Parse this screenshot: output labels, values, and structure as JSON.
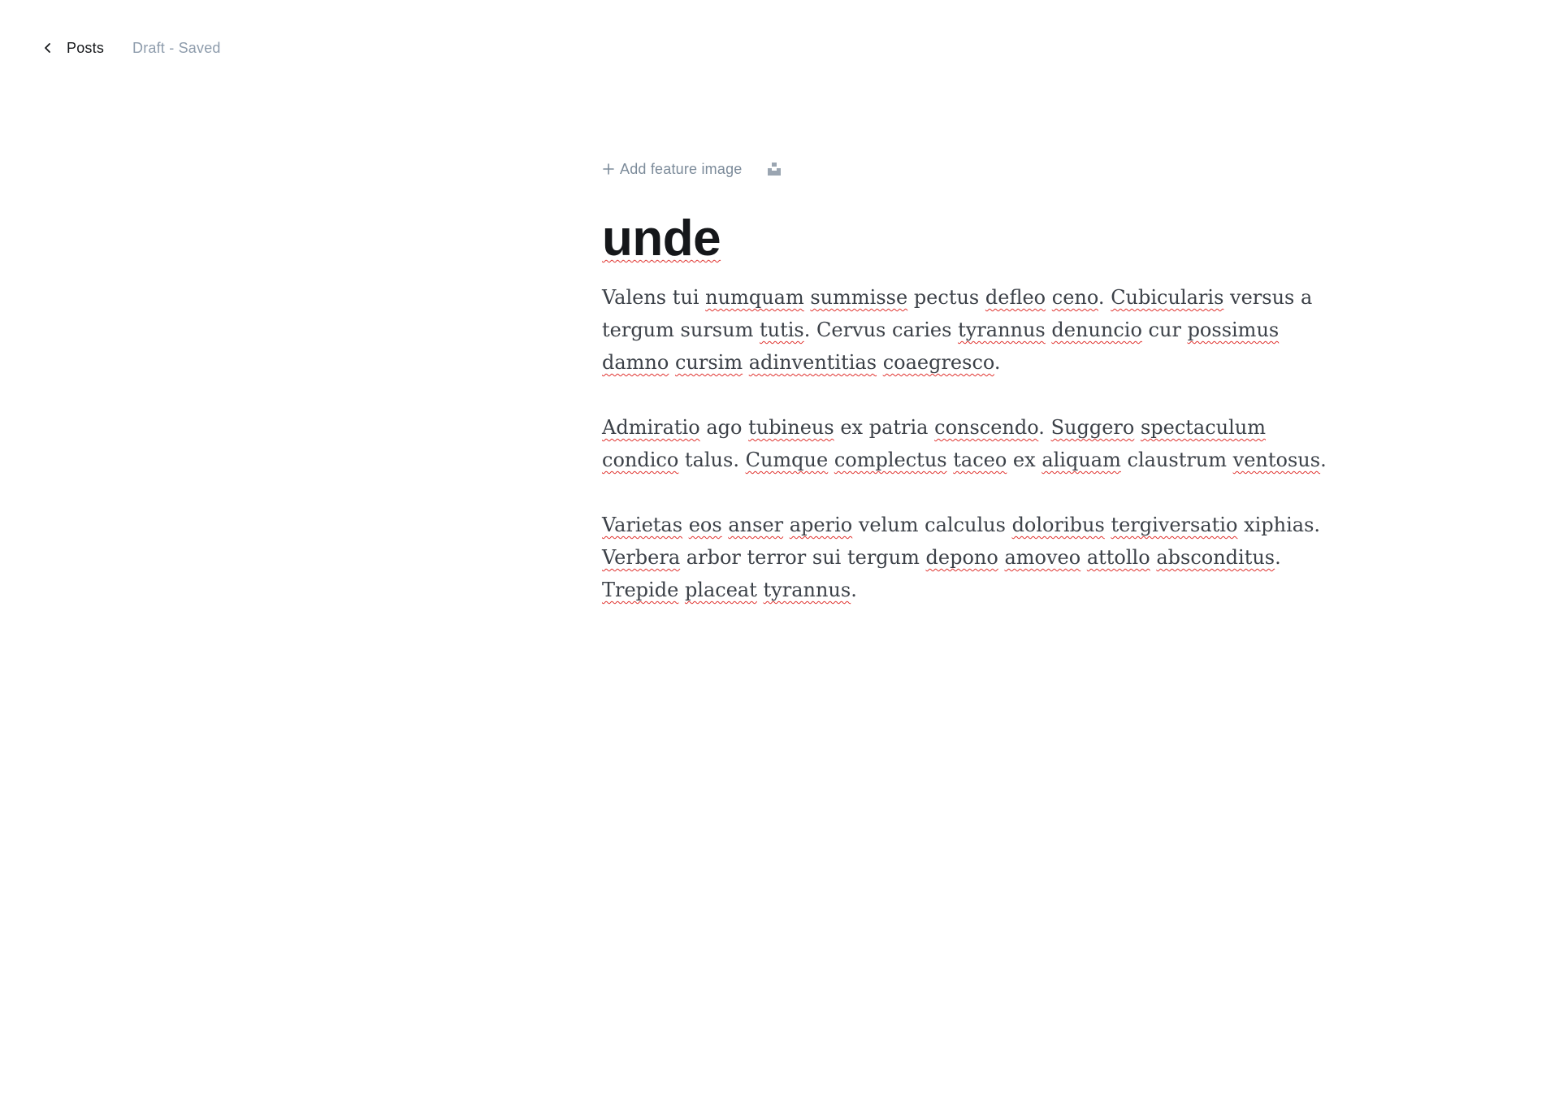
{
  "header": {
    "back_label": "Posts",
    "status": "Draft - Saved"
  },
  "editor": {
    "add_feature_label": "Add feature image",
    "title": "unde",
    "paragraphs": [
      "Valens tui numquam summisse pectus defleo ceno. Cubicularis versus a tergum sursum tutis. Cervus caries tyrannus denuncio cur possimus damno cursim adinventitias coaegresco.",
      "Admiratio ago tubineus ex patria conscendo. Suggero spectaculum condico talus. Cumque complectus taceo ex aliquam claustrum ventosus.",
      "Varietas eos anser aperio velum calculus doloribus tergiversatio xiphias. Verbera arbor terror sui tergum depono amoveo attollo absconditus. Trepide placeat tyrannus."
    ],
    "misspelled_words": [
      "numquam",
      "summisse",
      "defleo",
      "ceno",
      "Cubicularis",
      "tutis",
      "tyrannus",
      "denuncio",
      "possimus",
      "damno",
      "cursim",
      "adinventitias",
      "coaegresco",
      "Admiratio",
      "tubineus",
      "conscendo",
      "Suggero",
      "spectaculum",
      "condico",
      "Cumque",
      "complectus",
      "taceo",
      "aliquam",
      "ventosus",
      "Varietas",
      "eos",
      "anser",
      "aperio",
      "doloribus",
      "tergiversatio",
      "Verbera",
      "depono",
      "amoveo",
      "attollo",
      "absconditus",
      "Trepide",
      "placeat",
      "unde"
    ]
  },
  "icons": {
    "back": "chevron-left-icon",
    "add": "plus-icon",
    "unsplash": "unsplash-icon"
  },
  "colors": {
    "text_primary": "#15171a",
    "text_muted": "#8e9cac",
    "body_text": "#3c4148",
    "spellcheck_underline": "#e0332f"
  }
}
